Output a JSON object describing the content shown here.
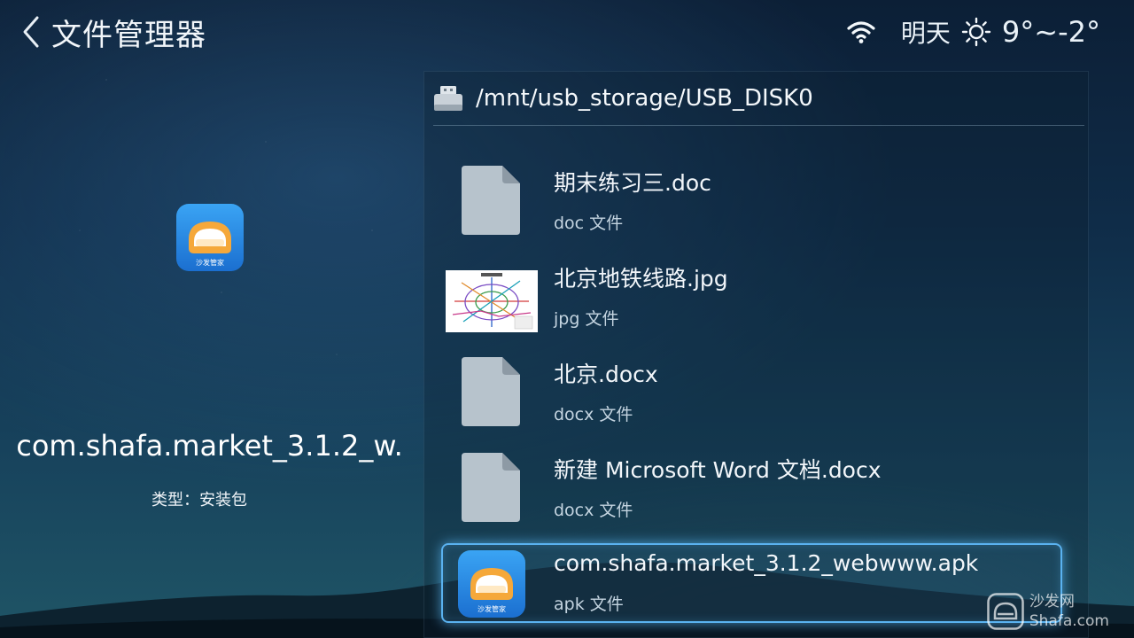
{
  "header": {
    "title": "文件管理器",
    "weather_day": "明天",
    "temperature": "9°~-2°"
  },
  "detail": {
    "name": "com.shafa.market_3.1.2_w.",
    "type_label": "类型：安装包",
    "icon_caption": "沙发管家"
  },
  "browser": {
    "path": "/mnt/usb_storage/USB_DISK0",
    "files": [
      {
        "name": "期末练习三.doc",
        "type": "doc 文件",
        "icon": "document-icon"
      },
      {
        "name": "北京地铁线路.jpg",
        "type": "jpg 文件",
        "icon": "image-thumbnail"
      },
      {
        "name": "北京.docx",
        "type": "docx 文件",
        "icon": "document-icon"
      },
      {
        "name": "新建 Microsoft Word 文档.docx",
        "type": "docx 文件",
        "icon": "document-icon"
      },
      {
        "name": "com.shafa.market_3.1.2_webwww.apk",
        "type": "apk 文件",
        "icon": "app-icon",
        "selected": true
      }
    ]
  },
  "watermark": {
    "line1": "沙发网",
    "line2": "Shafa.com"
  },
  "colors": {
    "focus_border": "#5ab2f0",
    "app_icon_blue": "#2a8ee8",
    "sofa_orange": "#f5a83a"
  }
}
